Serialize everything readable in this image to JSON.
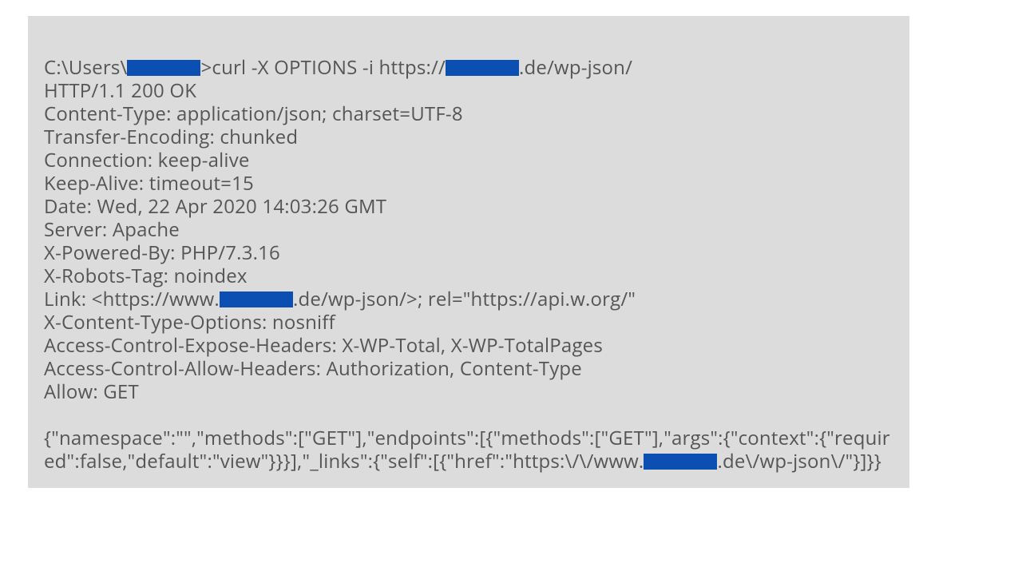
{
  "cmd": {
    "prefix": "C:\\Users\\",
    "mid": ">curl  -X OPTIONS -i https://",
    "suffix": ".de/wp-json/"
  },
  "headers": {
    "h0": "HTTP/1.1 200 OK",
    "h1": "Content-Type: application/json; charset=UTF-8",
    "h2": "Transfer-Encoding: chunked",
    "h3": "Connection: keep-alive",
    "h4": "Keep-Alive: timeout=15",
    "h5": "Date: Wed, 22 Apr 2020 14:03:26 GMT",
    "h6": "Server: Apache",
    "h7": "X-Powered-By: PHP/7.3.16",
    "h8": "X-Robots-Tag: noindex",
    "link_a": "Link: <https://www.",
    "link_b": ".de/wp-json/>; rel=\"https://api.w.org/\"",
    "h9": "X-Content-Type-Options: nosniff",
    "h10": "Access-Control-Expose-Headers:  X-WP-Total, X-WP-TotalPages",
    "h11": "Access-Control-Allow-Headers:  Authorization, Content-Type",
    "h12": "Allow: GET"
  },
  "body": {
    "part1": "{\"namespace\":\"\",\"methods\":[\"GET\"],\"endpoints\":[{\"methods\":[\"GET\"],\"args\":{\"context\":{\"required\":false,\"default\":\"view\"}}}],\"_links\":{\"self\":[{\"href\":\"https:\\/\\/www.",
    "part2": ".de\\/wp-json\\/\"}]}}"
  },
  "redaction": {
    "w1": "92px",
    "w2": "92px",
    "w3": "92px",
    "w4": "92px"
  }
}
